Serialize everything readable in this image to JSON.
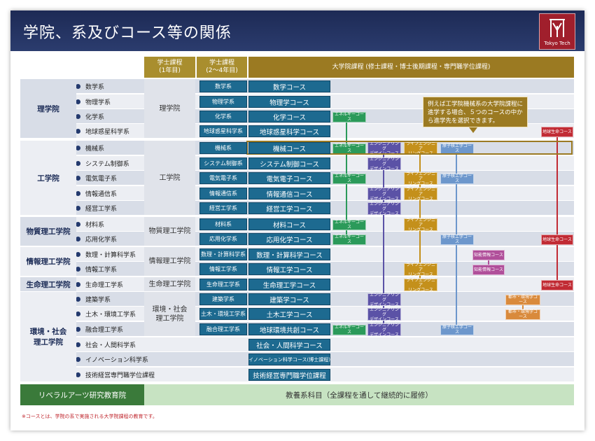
{
  "header": {
    "title": "学院、系及びコース等の関係",
    "logo_text": "Tokyo Tech"
  },
  "columns": {
    "bachelor_first": "学士課程\n(1年目)",
    "bachelor_rest": "学士課程\n(2〜4年目)",
    "graduate": "大学院課程 (修士課程・博士後期課程・専門職学位課程)"
  },
  "schools": [
    {
      "name": "理学院",
      "first_year": "理学院"
    },
    {
      "name": "工学院",
      "first_year": "工学院"
    },
    {
      "name": "物質理工学院",
      "first_year": "物質理工学院"
    },
    {
      "name": "情報理工学院",
      "first_year": "情報理工学院"
    },
    {
      "name": "生命理工学院",
      "first_year": "生命理工学院"
    },
    {
      "name": "環境・社会\n理工学院",
      "first_year": "環境・社会\n理工学院"
    }
  ],
  "rows": [
    {
      "dept": "数学系",
      "ub": "数学系",
      "grad": "数学コース"
    },
    {
      "dept": "物理学系",
      "ub": "物理学系",
      "grad": "物理学コース"
    },
    {
      "dept": "化学系",
      "ub": "化学系",
      "grad": "化学コース"
    },
    {
      "dept": "地球惑星科学系",
      "ub": "地球惑星科学系",
      "grad": "地球惑星科学コース"
    },
    {
      "dept": "機械系",
      "ub": "機械系",
      "grad": "機械コース"
    },
    {
      "dept": "システム制御系",
      "ub": "システム制御系",
      "grad": "システム制御コース"
    },
    {
      "dept": "電気電子系",
      "ub": "電気電子系",
      "grad": "電気電子コース"
    },
    {
      "dept": "情報通信系",
      "ub": "情報通信系",
      "grad": "情報通信コース"
    },
    {
      "dept": "経営工学系",
      "ub": "経営工学系",
      "grad": "経営工学コース"
    },
    {
      "dept": "材料系",
      "ub": "材料系",
      "grad": "材料コース"
    },
    {
      "dept": "応用化学系",
      "ub": "応用化学系",
      "grad": "応用化学コース"
    },
    {
      "dept": "数理・計算科学系",
      "ub": "数理・計算科学系",
      "grad": "数理・計算科学コース"
    },
    {
      "dept": "情報工学系",
      "ub": "情報工学系",
      "grad": "情報工学コース"
    },
    {
      "dept": "生命理工学系",
      "ub": "生命理工学系",
      "grad": "生命理工学コース"
    },
    {
      "dept": "建築学系",
      "ub": "建築学系",
      "grad": "建築学コース"
    },
    {
      "dept": "土木・環境工学系",
      "ub": "土木・環境工学系",
      "grad": "土木工学コース"
    },
    {
      "dept": "融合理工学系",
      "ub": "融合理工学系",
      "grad": "地球環境共創コース"
    },
    {
      "dept": "社会・人間科学系",
      "ub": "",
      "grad": "社会・人間科学コース"
    },
    {
      "dept": "イノベーション科学系",
      "ub": "",
      "grad": "イノベーション科学コース(博士課程)"
    },
    {
      "dept": "技術経営専門職学位課程",
      "ub": "",
      "grad": "技術経営専門職学位課程"
    }
  ],
  "tags": {
    "energy": "エネルギーコース",
    "engineering": "エンジニアリング\nデザインコース",
    "life": "ライフエンジニア\nリングコース",
    "nuclear": "原子核工学コース",
    "earth_life": "地球生命コース",
    "knowledge": "知能情報コース",
    "urban": "都市・環境学コース"
  },
  "callout": "例えば工学院機械系の大学院課程に進学する場合、５つのコースの中から進学先を選択できます。",
  "liberal_arts": {
    "name": "リベラルアーツ研究教育院",
    "bar": "教養系科目（全課程を通して継続的に履修）"
  },
  "footnote": "※コースとは、学院の系で実施される大学院課程の教育です。",
  "colors": {
    "energy": "#2b9a5a",
    "engineering": "#5b52a6",
    "life": "#c4901b",
    "nuclear": "#6d97cc",
    "earth_life": "#c12b34",
    "knowledge": "#b04f9a",
    "urban": "#d98a3c",
    "course": "#1d6a90",
    "header_gold": "#9b7a22"
  }
}
